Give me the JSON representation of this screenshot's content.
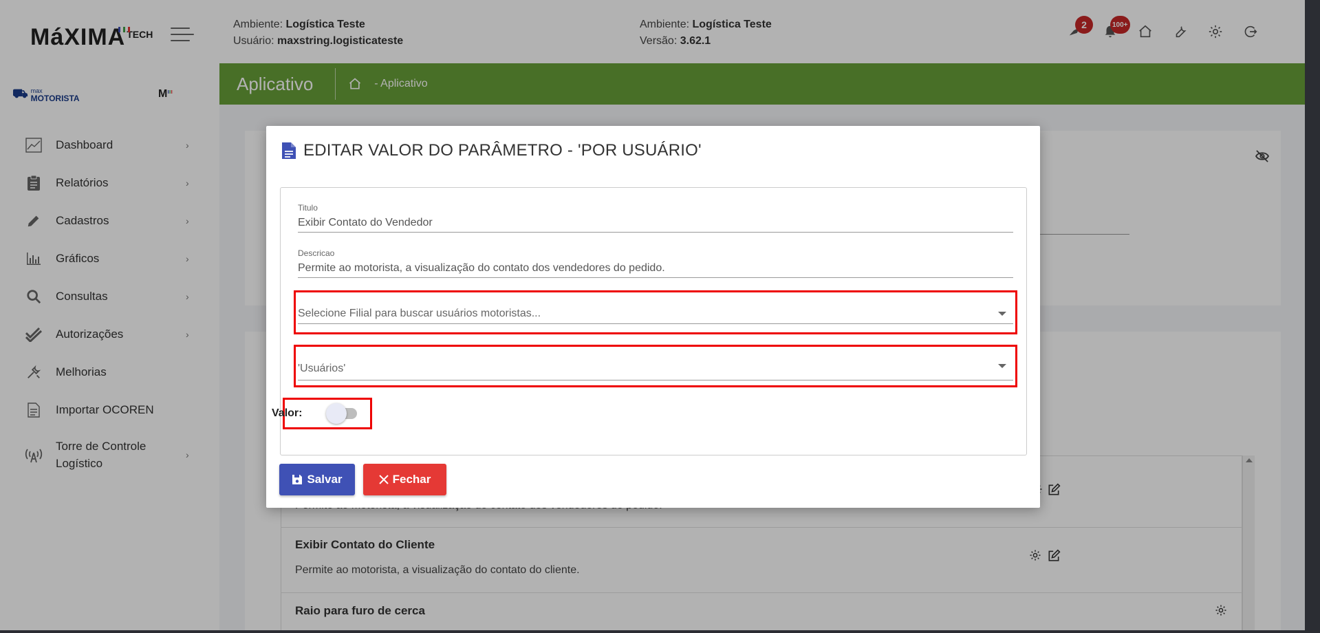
{
  "header": {
    "logo_main": "MáXIMA",
    "logo_tech": "TECH",
    "env_left": {
      "ambiente_label": "Ambiente:",
      "ambiente_value": "Logística Teste",
      "usuario_label": "Usuário:",
      "usuario_value": "maxstring.logisticateste"
    },
    "env_mid": {
      "ambiente_label": "Ambiente:",
      "ambiente_value": "Logística Teste",
      "versao_label": "Versão:",
      "versao_value": "3.62.1"
    },
    "badge_bird": "2",
    "badge_bell": "100+"
  },
  "sidebar": {
    "brand_small": "max",
    "brand": "MOTORISTA",
    "brand_right": "M",
    "items": [
      {
        "label": "Dashboard",
        "icon": "chart-line-icon"
      },
      {
        "label": "Relatórios",
        "icon": "clipboard-icon"
      },
      {
        "label": "Cadastros",
        "icon": "pencil-icon"
      },
      {
        "label": "Gráficos",
        "icon": "bar-chart-icon"
      },
      {
        "label": "Consultas",
        "icon": "search-icon"
      },
      {
        "label": "Autorizações",
        "icon": "double-check-icon"
      },
      {
        "label": "Melhorias",
        "icon": "tools-icon"
      },
      {
        "label": "Importar OCOREN",
        "icon": "file-icon"
      },
      {
        "label": "Torre de Controle Logístico",
        "icon": "antenna-icon"
      }
    ]
  },
  "titlebar": {
    "title": "Aplicativo",
    "breadcrumb": "- Aplicativo"
  },
  "background_list": {
    "row1_desc": "Permite ao motorista, a visualização do contato dos vendedores do pedido.",
    "row2_title": "Exibir Contato do Cliente",
    "row2_desc": "Permite ao motorista, a visualização do contato do cliente.",
    "row3_title": "Raio para furo de cerca"
  },
  "modal": {
    "title": "EDITAR VALOR DO PARÂMETRO - 'POR USUÁRIO'",
    "titulo_label": "Titulo",
    "titulo_value": "Exibir Contato do Vendedor",
    "descricao_label": "Descricao",
    "descricao_value": "Permite ao motorista, a visualização do contato dos vendedores do pedido.",
    "filial_placeholder": "Selecione Filial para buscar usuários motoristas...",
    "usuarios_value": "'Usuários'",
    "valor_label": "Valor:",
    "valor_on": false,
    "save_label": "Salvar",
    "close_label": "Fechar"
  },
  "colors": {
    "accent": "#689f38",
    "primary": "#3f51b5",
    "danger": "#e53935",
    "highlight": "#ee0000"
  }
}
